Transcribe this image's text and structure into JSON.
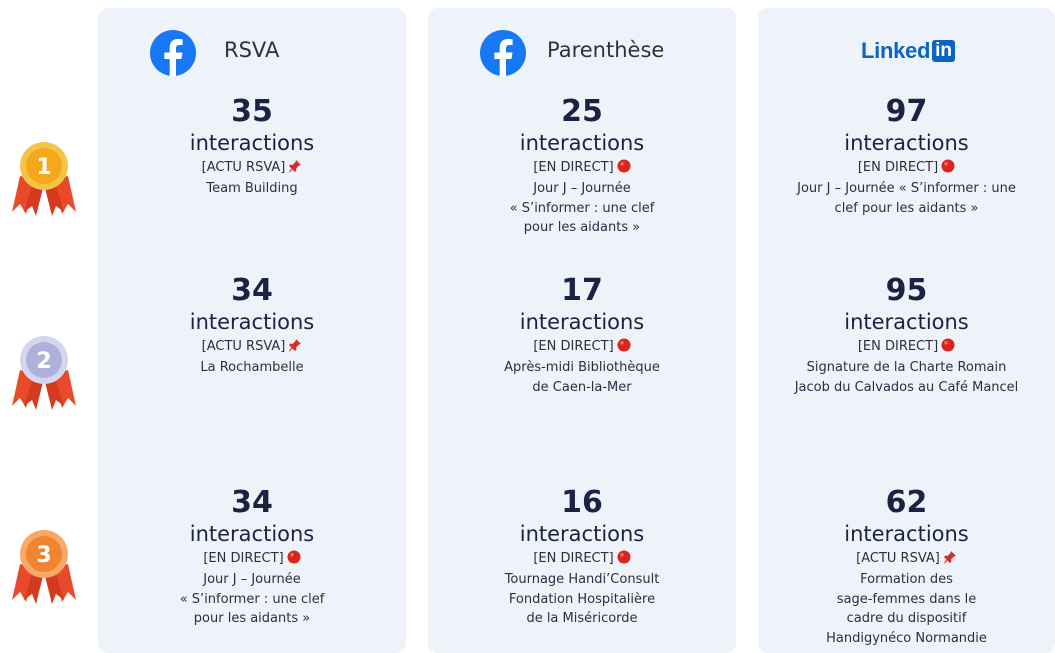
{
  "ranks": [
    {
      "icon": "gold-medal-icon",
      "label": "1",
      "color": "#f4b21b"
    },
    {
      "icon": "silver-medal-icon",
      "label": "2",
      "color": "#b3b6de"
    },
    {
      "icon": "bronze-medal-icon",
      "label": "3",
      "color": "#f08a3a"
    }
  ],
  "ribbon_color": "#e84a2b",
  "columns": [
    {
      "platform": "facebook",
      "icon": "facebook-icon",
      "title": "RSVA",
      "entries": [
        {
          "count": "35",
          "unit": "interactions",
          "tag": "[ACTU RSVA]",
          "tag_icon": "pushpin-icon",
          "lines": [
            "Team Building"
          ]
        },
        {
          "count": "34",
          "unit": "interactions",
          "tag": "[ACTU RSVA]",
          "tag_icon": "pushpin-icon",
          "lines": [
            "La Rochambelle"
          ]
        },
        {
          "count": "34",
          "unit": "interactions",
          "tag": "[EN DIRECT]",
          "tag_icon": "red-circle-icon",
          "lines": [
            "Jour J – Journée",
            "« S’informer : une clef",
            "pour les aidants »"
          ]
        }
      ]
    },
    {
      "platform": "facebook",
      "icon": "facebook-icon",
      "title": "Parenthèse",
      "entries": [
        {
          "count": "25",
          "unit": "interactions",
          "tag": "[EN DIRECT]",
          "tag_icon": "red-circle-icon",
          "lines": [
            "Jour J – Journée",
            "« S’informer : une clef",
            "pour les aidants »"
          ]
        },
        {
          "count": "17",
          "unit": "interactions",
          "tag": "[EN DIRECT]",
          "tag_icon": "red-circle-icon",
          "lines": [
            "Après-midi Bibliothèque",
            "de Caen-la-Mer"
          ]
        },
        {
          "count": "16",
          "unit": "interactions",
          "tag": "[EN DIRECT]",
          "tag_icon": "red-circle-icon",
          "lines": [
            "Tournage Handi’Consult",
            "Fondation Hospitalière",
            "de la Miséricorde"
          ]
        }
      ]
    },
    {
      "platform": "linkedin",
      "icon": "linkedin-logo-icon",
      "logo_text": "Linked",
      "logo_box": "in",
      "entries": [
        {
          "count": "97",
          "unit": "interactions",
          "tag": "[EN DIRECT]",
          "tag_icon": "red-circle-icon",
          "lines": [
            "Jour J – Journée « S’informer : une",
            "clef pour les aidants »"
          ]
        },
        {
          "count": "95",
          "unit": "interactions",
          "tag": "[EN DIRECT]",
          "tag_icon": "red-circle-icon",
          "lines": [
            "Signature de la Charte Romain",
            "Jacob du Calvados au Café Mancel"
          ]
        },
        {
          "count": "62",
          "unit": "interactions",
          "tag": "[ACTU RSVA]",
          "tag_icon": "pushpin-icon",
          "lines": [
            "Formation des",
            "sage-femmes dans le",
            "cadre du dispositif",
            "Handigynéco Normandie"
          ]
        }
      ]
    }
  ]
}
